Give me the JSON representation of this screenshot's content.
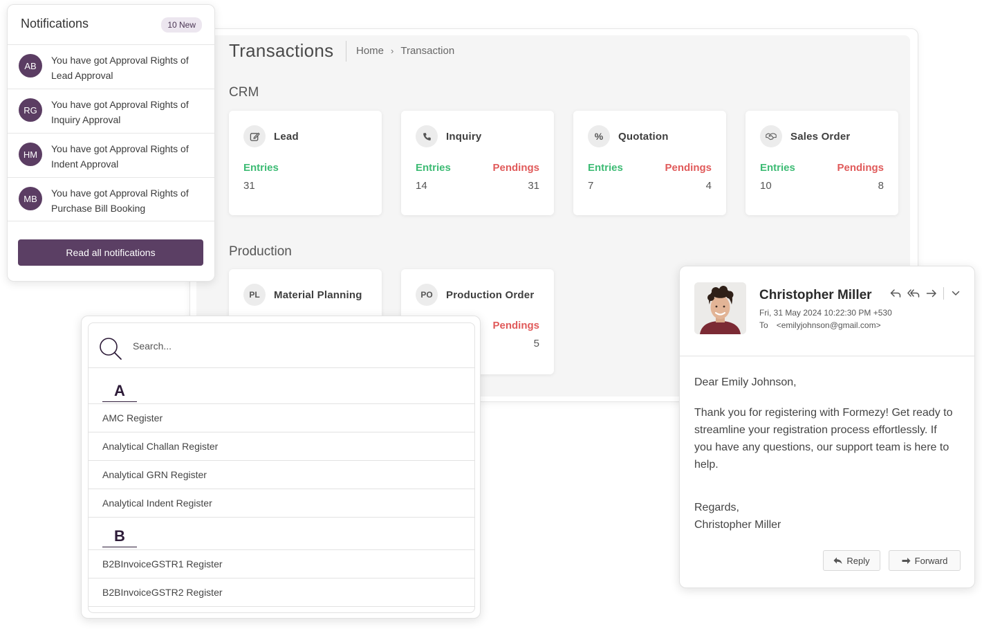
{
  "transactions": {
    "title": "Transactions",
    "breadcrumb": {
      "home": "Home",
      "separator": "›",
      "current": "Transaction"
    },
    "crm": {
      "section_title": "CRM",
      "cards": [
        {
          "icon": "edit-icon",
          "name": "Lead",
          "entries_label": "Entries",
          "entries": "31"
        },
        {
          "icon": "phone-icon",
          "name": "Inquiry",
          "entries_label": "Entries",
          "entries": "14",
          "pendings_label": "Pendings",
          "pendings": "31"
        },
        {
          "icon": "percent-icon",
          "name": "Quotation",
          "entries_label": "Entries",
          "entries": "7",
          "pendings_label": "Pendings",
          "pendings": "4"
        },
        {
          "icon": "handshake-icon",
          "name": "Sales Order",
          "entries_label": "Entries",
          "entries": "10",
          "pendings_label": "Pendings",
          "pendings": "8"
        }
      ]
    },
    "production": {
      "section_title": "Production",
      "cards": [
        {
          "badge": "PL",
          "name": "Material Planning"
        },
        {
          "badge": "PO",
          "name": "Production Order",
          "pendings_label": "Pendings",
          "pendings": "5"
        }
      ]
    }
  },
  "notifications": {
    "title": "Notifications",
    "badge": "10 New",
    "items": [
      {
        "initials": "AB",
        "text": "You have got Approval Rights of Lead Approval"
      },
      {
        "initials": "RG",
        "text": "You have got Approval Rights of Inquiry Approval"
      },
      {
        "initials": "HM",
        "text": "You have got Approval Rights of Indent Approval"
      },
      {
        "initials": "MB",
        "text": "You have got Approval Rights of Purchase Bill Booking"
      }
    ],
    "read_all_label": "Read all notifications"
  },
  "register_search": {
    "placeholder": "Search...",
    "groups": [
      {
        "letter": "A",
        "items": [
          "AMC Register",
          "Analytical Challan Register",
          "Analytical GRN Register",
          "Analytical Indent Register"
        ]
      },
      {
        "letter": "B",
        "items": [
          "B2BInvoiceGSTR1 Register",
          "B2BInvoiceGSTR2 Register"
        ]
      }
    ]
  },
  "email": {
    "sender": "Christopher Miller",
    "date": "Fri, 31 May 2024 10:22:30 PM +530",
    "to_label": "To",
    "to": "<emilyjohnson@gmail.com>",
    "greeting": "Dear Emily Johnson,",
    "body": "Thank you for registering with Formezy! Get ready to streamline your registration process effortlessly. If you have any questions, our support team is here to help.",
    "regards": "Regards,",
    "signature": "Christopher Miller",
    "reply_label": "Reply",
    "forward_label": "Forward"
  },
  "colors": {
    "primary": "#5b3f64",
    "entries_green": "#3dbb74",
    "pendings_red": "#e05a5a",
    "badge_bg": "#ece6ef"
  }
}
